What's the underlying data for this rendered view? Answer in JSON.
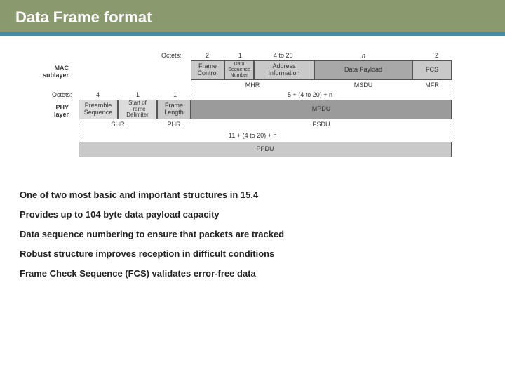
{
  "header": {
    "title": "Data Frame format"
  },
  "diagram": {
    "layer_labels": {
      "mac": "MAC\nsublayer",
      "phy": "PHY\nlayer"
    },
    "mac": {
      "octets_label": "Octets:",
      "cols": [
        {
          "octets": "2",
          "name": "Frame Control",
          "group": "MHR"
        },
        {
          "octets": "1",
          "name": "Data Sequence Number",
          "group": "MHR"
        },
        {
          "octets": "4 to 20",
          "name": "Address Information",
          "group": "MHR"
        },
        {
          "octets": "n",
          "name": "Data Payload",
          "group": "MSDU"
        },
        {
          "octets": "2",
          "name": "FCS",
          "group": "MFR"
        }
      ],
      "group_labels": [
        "MHR",
        "MSDU",
        "MFR"
      ]
    },
    "phy": {
      "octets_label": "Octets:",
      "cols": [
        {
          "octets": "4",
          "name": "Preamble Sequence",
          "group": "SHR"
        },
        {
          "octets": "1",
          "name": "Start of Frame Delimiter",
          "group": "SHR"
        },
        {
          "octets": "1",
          "name": "Frame Length",
          "group": "PHR"
        }
      ],
      "right_octets": "5 + (4 to 20) + n",
      "mpdu_label": "MPDU",
      "group_labels": [
        "SHR",
        "PHR",
        "PSDU"
      ]
    },
    "ppdu": {
      "length_label": "11 + (4 to 20) + n",
      "name": "PPDU"
    }
  },
  "bullets": {
    "items": [
      "One of two most basic and important structures in 15.4",
      "Provides up to 104 byte data payload capacity",
      "Data sequence numbering to ensure that packets are tracked",
      "Robust structure improves reception in difficult conditions",
      "Frame Check Sequence (FCS) validates error-free data"
    ]
  }
}
